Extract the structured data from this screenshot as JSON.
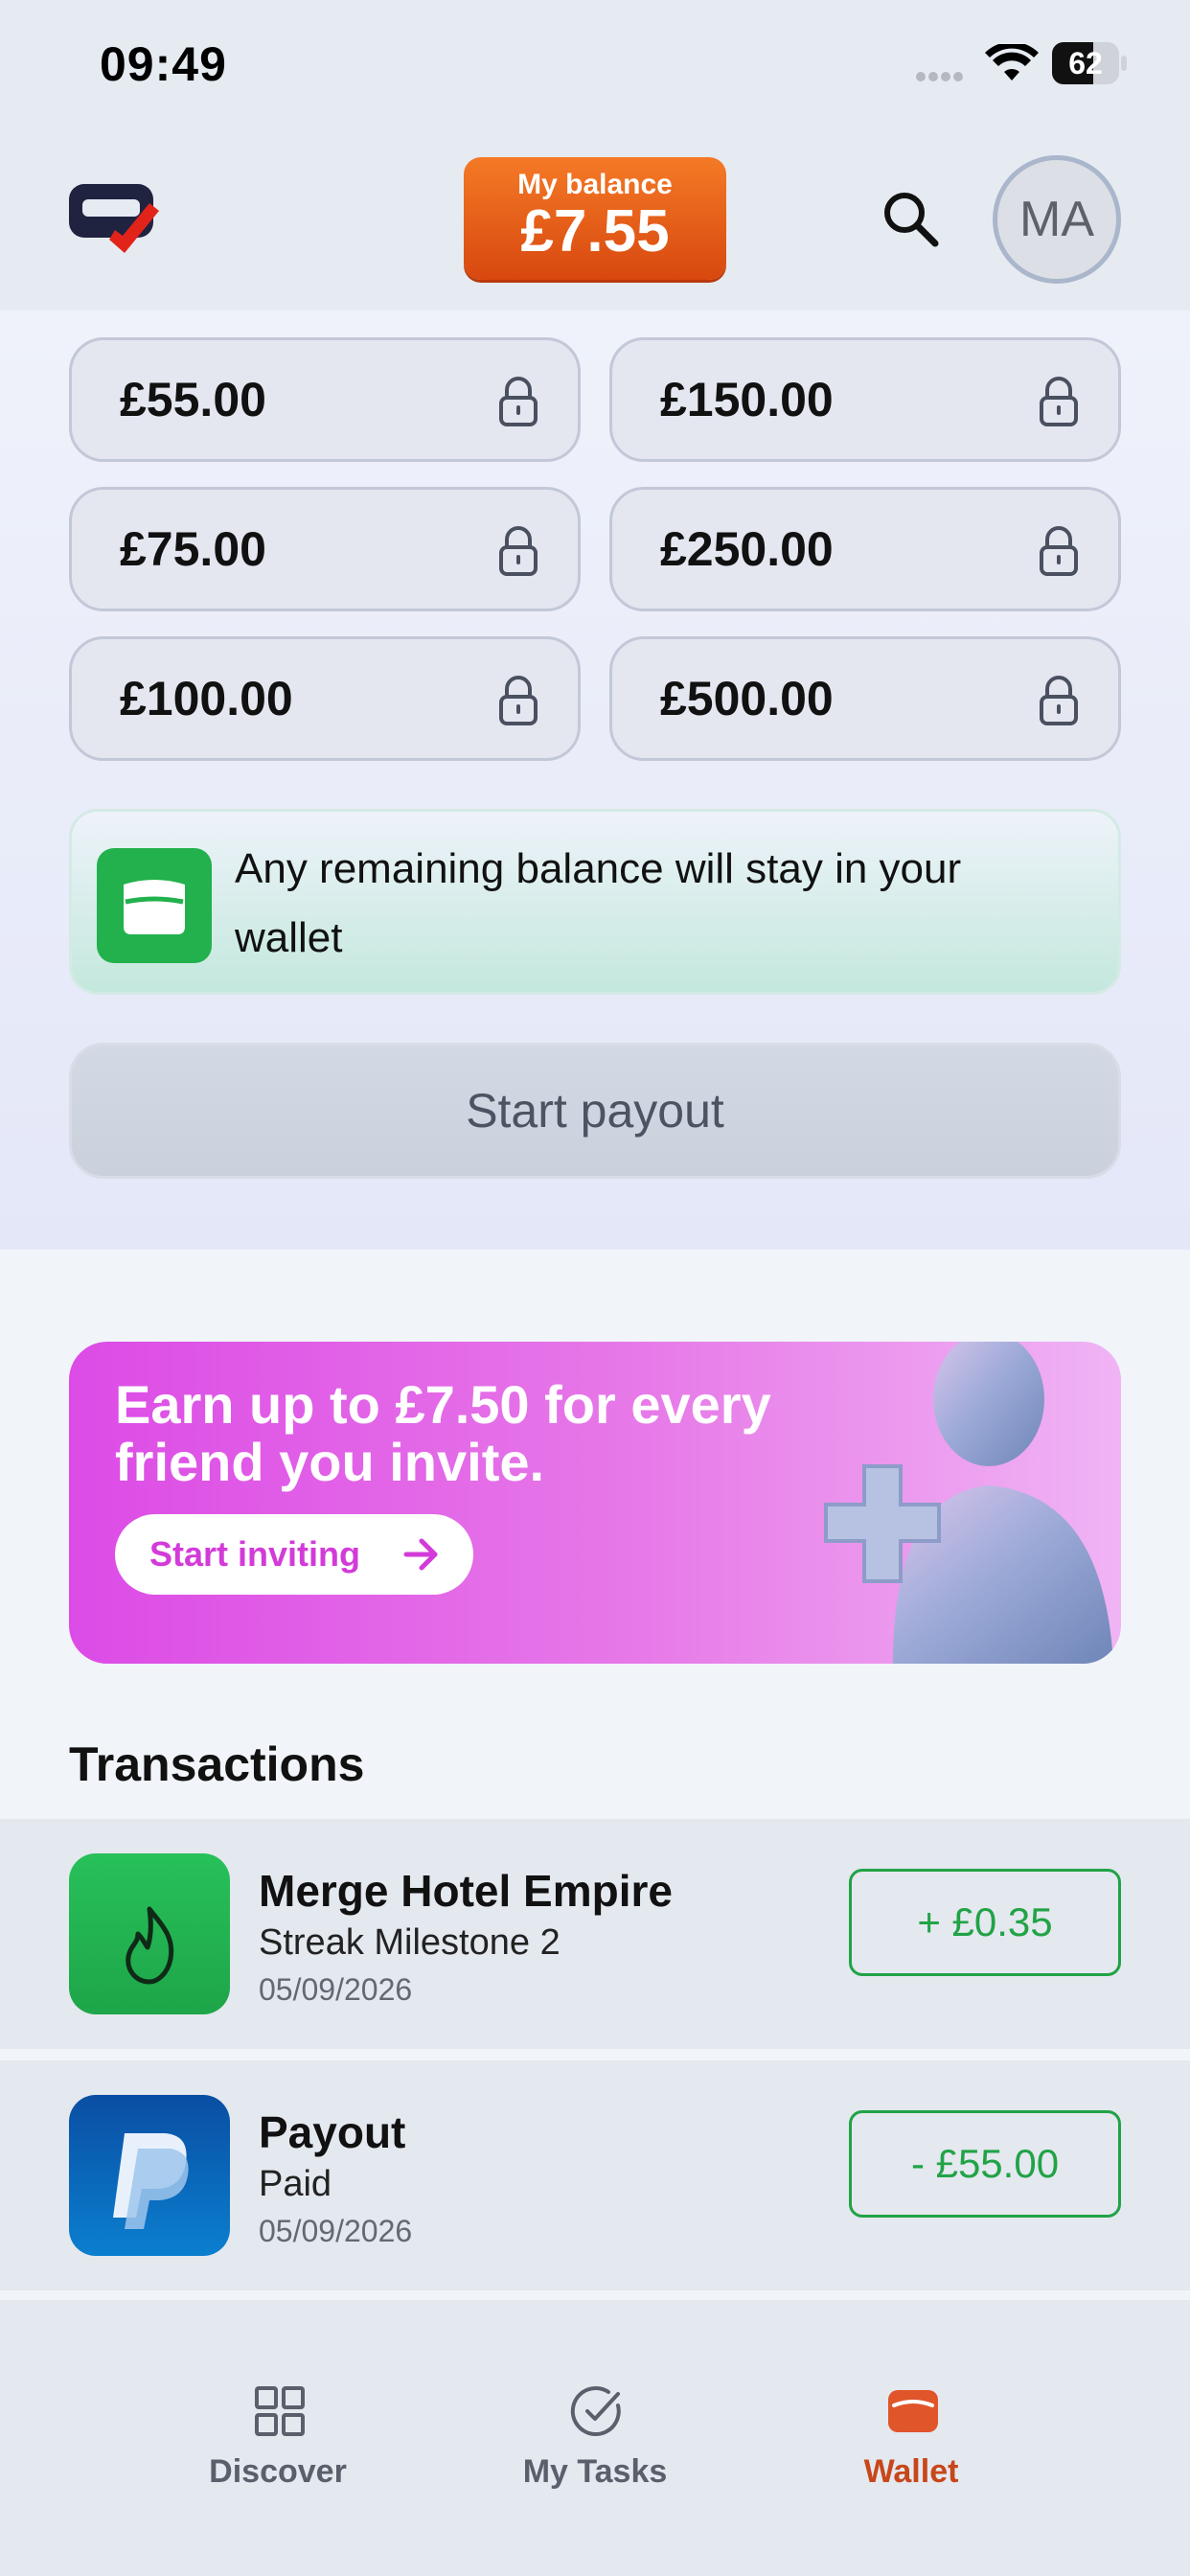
{
  "status_bar": {
    "time": "09:49",
    "battery": "62"
  },
  "header": {
    "balance_label": "My balance",
    "balance_amount": "£7.55",
    "avatar_initials": "MA",
    "brand_color": "#e35b17"
  },
  "payout": {
    "amounts": [
      {
        "label": "£55.00",
        "locked": true
      },
      {
        "label": "£150.00",
        "locked": true
      },
      {
        "label": "£75.00",
        "locked": true
      },
      {
        "label": "£250.00",
        "locked": true
      },
      {
        "label": "£100.00",
        "locked": true
      },
      {
        "label": "£500.00",
        "locked": true
      }
    ],
    "info_text": "Any remaining balance will stay in your wallet",
    "start_label": "Start payout"
  },
  "invite": {
    "title": "Earn up to £7.50 for every friend you invite.",
    "button_label": "Start inviting"
  },
  "transactions": {
    "heading": "Transactions",
    "items": [
      {
        "title": "Merge Hotel Empire",
        "subtitle": "Streak Milestone 2",
        "date": "05/09/2026",
        "amount": "+ £0.35",
        "icon": "flame-icon"
      },
      {
        "title": "Payout",
        "subtitle": "Paid",
        "date": "05/09/2026",
        "amount": "- £55.00",
        "icon": "paypal-icon"
      }
    ]
  },
  "nav": {
    "items": [
      {
        "label": "Discover",
        "icon": "grid-icon",
        "active": false
      },
      {
        "label": "My Tasks",
        "icon": "check-circle-icon",
        "active": false
      },
      {
        "label": "Wallet",
        "icon": "wallet-icon",
        "active": true
      }
    ]
  }
}
